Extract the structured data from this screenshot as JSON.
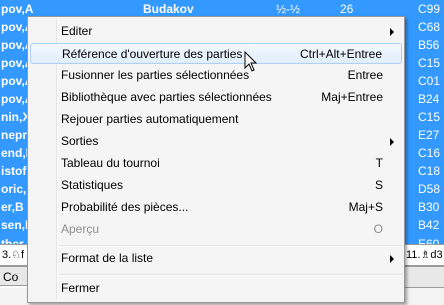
{
  "background": {
    "rows": [
      {
        "player": "pov,A",
        "opponent": "Budakov",
        "result": "½-½",
        "num": "26",
        "eco": "C99"
      },
      {
        "player": "pov,A",
        "opponent": "",
        "result": "",
        "num": "",
        "eco": "C68"
      },
      {
        "player": "pov,A",
        "opponent": "",
        "result": "",
        "num": "",
        "eco": "B56"
      },
      {
        "player": "pov,A",
        "opponent": "",
        "result": "",
        "num": "",
        "eco": "C15"
      },
      {
        "player": "pov,A",
        "opponent": "",
        "result": "",
        "num": "",
        "eco": "C01"
      },
      {
        "player": "pov,A",
        "opponent": "",
        "result": "",
        "num": "",
        "eco": "B24"
      },
      {
        "player": "nin,X",
        "opponent": "",
        "result": "",
        "num": "",
        "eco": "C15"
      },
      {
        "player": "nepr",
        "opponent": "",
        "result": "",
        "num": "",
        "eco": "E27"
      },
      {
        "player": "end,E",
        "opponent": "",
        "result": "",
        "num": "",
        "eco": "C16"
      },
      {
        "player": "istof",
        "opponent": "",
        "result": "",
        "num": "",
        "eco": "C18"
      },
      {
        "player": "oric,",
        "opponent": "",
        "result": "",
        "num": "",
        "eco": "D58"
      },
      {
        "player": "er,B",
        "opponent": "",
        "result": "",
        "num": "",
        "eco": "B30"
      },
      {
        "player": "sen,B",
        "opponent": "",
        "result": "",
        "num": "",
        "eco": "B42"
      },
      {
        "player": "ther",
        "opponent": "",
        "result": "",
        "num": "",
        "eco": "E60"
      }
    ],
    "notation_left": "3.♘f",
    "notation_right": "11.♗d3",
    "tab_label": "Co"
  },
  "menu": {
    "items": [
      {
        "label": "Editer",
        "shortcut": "",
        "submenu": true,
        "disabled": false,
        "highlighted": false
      },
      {
        "label": "Référence d'ouverture des parties",
        "shortcut": "Ctrl+Alt+Entree",
        "submenu": false,
        "disabled": false,
        "highlighted": true
      },
      {
        "label": "Fusionner les parties sélectionnées",
        "shortcut": "Entree",
        "submenu": false,
        "disabled": false,
        "highlighted": false
      },
      {
        "label": "Bibliothèque avec parties sélectionnées",
        "shortcut": "Maj+Entree",
        "submenu": false,
        "disabled": false,
        "highlighted": false
      },
      {
        "label": "Rejouer parties automatiquement",
        "shortcut": "",
        "submenu": false,
        "disabled": false,
        "highlighted": false
      },
      {
        "label": "Sorties",
        "shortcut": "",
        "submenu": true,
        "disabled": false,
        "highlighted": false
      },
      {
        "label": "Tableau du tournoi",
        "shortcut": "T",
        "submenu": false,
        "disabled": false,
        "highlighted": false
      },
      {
        "label": "Statistiques",
        "shortcut": "S",
        "submenu": false,
        "disabled": false,
        "highlighted": false
      },
      {
        "label": "Probabilité des pièces...",
        "shortcut": "Maj+S",
        "submenu": false,
        "disabled": false,
        "highlighted": false
      },
      {
        "label": "Aperçu",
        "shortcut": "O",
        "submenu": false,
        "disabled": true,
        "highlighted": false
      },
      {
        "label": "Format de la liste",
        "shortcut": "",
        "submenu": true,
        "disabled": false,
        "highlighted": false
      },
      {
        "label": "Fermer",
        "shortcut": "",
        "submenu": false,
        "disabled": false,
        "highlighted": false
      }
    ]
  },
  "colors": {
    "selection": "#3399ff",
    "menu_bg": "#f5f5f5",
    "highlight_border": "#aecff7",
    "disabled_text": "#8f8f8f"
  }
}
